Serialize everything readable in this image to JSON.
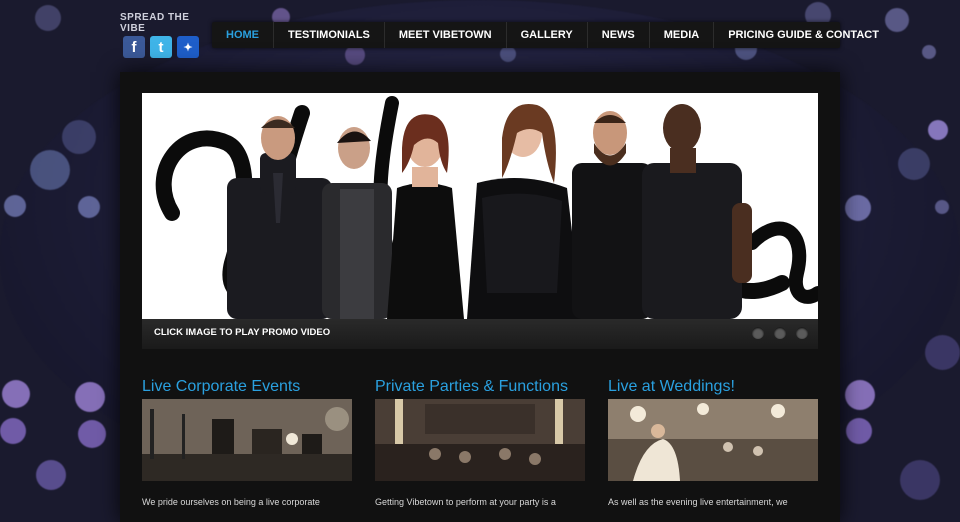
{
  "social": {
    "label": "SPREAD THE VIBE",
    "icons": [
      {
        "name": "facebook-icon",
        "glyph": "f"
      },
      {
        "name": "twitter-icon",
        "glyph": "t"
      },
      {
        "name": "myspace-icon",
        "glyph": "✦"
      }
    ]
  },
  "nav": {
    "items": [
      {
        "label": "HOME",
        "active": true
      },
      {
        "label": "TESTIMONIALS"
      },
      {
        "label": "MEET VIBETOWN"
      },
      {
        "label": "GALLERY"
      },
      {
        "label": "NEWS"
      },
      {
        "label": "MEDIA"
      },
      {
        "label": "PRICING GUIDE & CONTACT"
      }
    ]
  },
  "hero": {
    "caption": "CLICK IMAGE TO PLAY PROMO VIDEO",
    "slides": 3
  },
  "sections": [
    {
      "title": "Live Corporate Events",
      "text": "We pride ourselves on being a live corporate"
    },
    {
      "title": "Private Parties & Functions",
      "text": "Getting Vibetown to perform at your party is a"
    },
    {
      "title": "Live at Weddings!",
      "text": "As well as the evening live entertainment, we"
    }
  ],
  "colors": {
    "accent": "#2aa0df",
    "panel": "#111111",
    "nav": "#151515"
  }
}
